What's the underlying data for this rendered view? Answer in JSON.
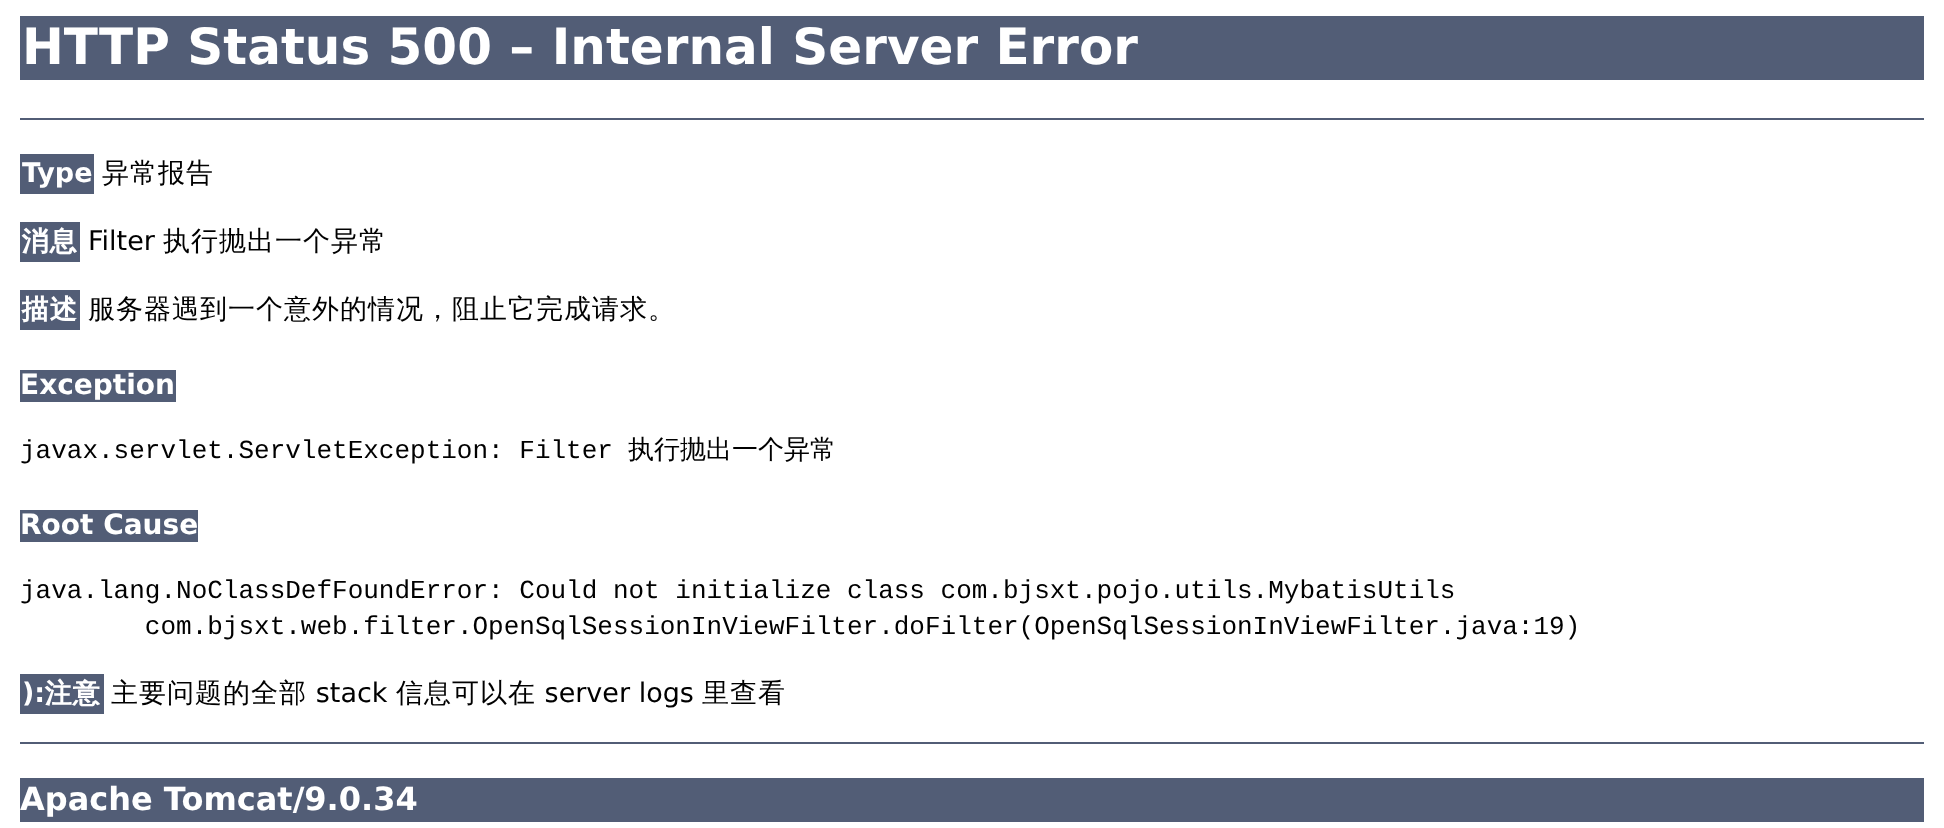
{
  "title": "HTTP Status 500 – Internal Server Error",
  "items": [
    {
      "kind": "field",
      "label": "Type",
      "text": "异常报告"
    },
    {
      "kind": "field",
      "label": "消息",
      "text": "Filter 执行抛出一个异常"
    },
    {
      "kind": "field",
      "label": "描述",
      "text": "服务器遇到一个意外的情况，阻止它完成请求。"
    },
    {
      "kind": "heading",
      "label": "Exception"
    },
    {
      "kind": "code",
      "lines": [
        "javax.servlet.ServletException: Filter 执行抛出一个异常"
      ]
    },
    {
      "kind": "heading",
      "label": "Root Cause"
    },
    {
      "kind": "code",
      "lines": [
        "java.lang.NoClassDefFoundError: Could not initialize class com.bjsxt.pojo.utils.MybatisUtils",
        "\tcom.bjsxt.web.filter.OpenSqlSessionInViewFilter.doFilter(OpenSqlSessionInViewFilter.java:19)"
      ]
    },
    {
      "kind": "field",
      "label": "):注意",
      "text": "主要问题的全部 stack 信息可以在 server logs 里查看"
    }
  ],
  "footer": "Apache Tomcat/9.0.34"
}
